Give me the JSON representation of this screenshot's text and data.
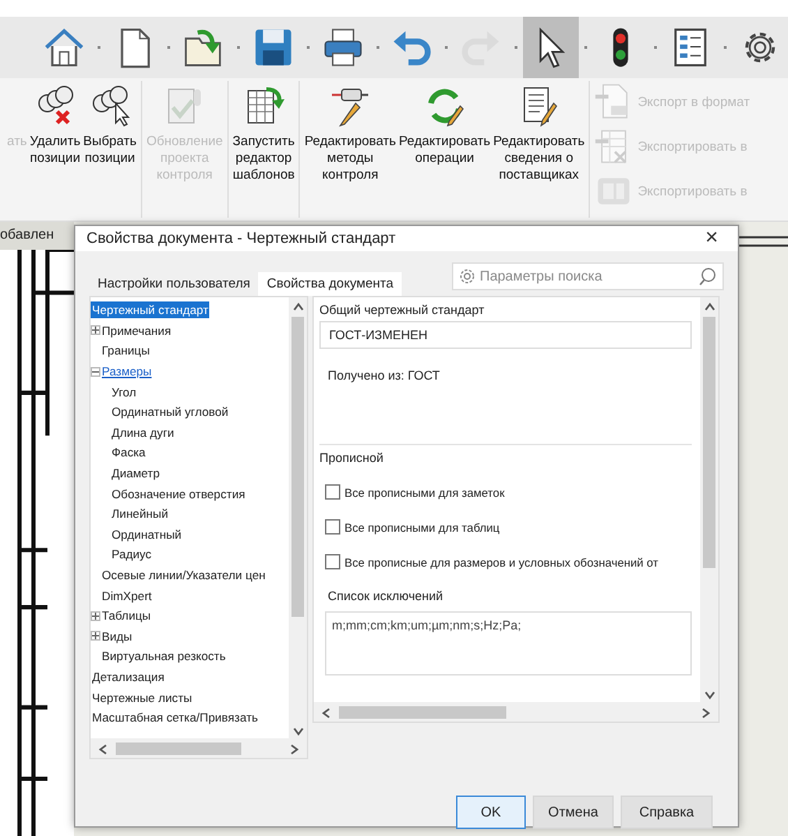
{
  "quick_toolbar": [
    {
      "kind": "home",
      "selected": false,
      "disabled": false
    },
    {
      "kind": "new",
      "selected": false,
      "disabled": false
    },
    {
      "kind": "open",
      "selected": false,
      "disabled": false
    },
    {
      "kind": "save",
      "selected": false,
      "disabled": false
    },
    {
      "kind": "print",
      "selected": false,
      "disabled": false
    },
    {
      "kind": "undo",
      "selected": false,
      "disabled": false
    },
    {
      "kind": "redo",
      "selected": false,
      "disabled": true
    },
    {
      "kind": "pointer",
      "selected": true,
      "disabled": false
    },
    {
      "kind": "traffic",
      "selected": false,
      "disabled": false
    },
    {
      "kind": "list",
      "selected": false,
      "disabled": false
    },
    {
      "kind": "gear",
      "selected": false,
      "disabled": false
    }
  ],
  "ribbon": {
    "buttons": [
      {
        "kind": "text",
        "lines": [
          "ать"
        ],
        "disabled": true
      },
      {
        "kind": "delete",
        "lines": [
          "Удалить",
          "позиции"
        ],
        "disabled": false
      },
      {
        "kind": "pick",
        "lines": [
          "Выбрать",
          "позиции"
        ],
        "disabled": false
      },
      {
        "kind": "update",
        "lines": [
          "Обновление",
          "проекта",
          "контроля"
        ],
        "disabled": true
      },
      {
        "kind": "template",
        "lines": [
          "Запустить",
          "редактор",
          "шаблонов"
        ],
        "disabled": false
      },
      {
        "kind": "gauge",
        "lines": [
          "Редактировать",
          "методы",
          "контроля"
        ],
        "disabled": false
      },
      {
        "kind": "cycle",
        "lines": [
          "Редактировать",
          "операции"
        ],
        "disabled": false
      },
      {
        "kind": "doc",
        "lines": [
          "Редактировать",
          "сведения о",
          "поставщиках"
        ],
        "disabled": false
      }
    ],
    "exports": [
      {
        "kind": "pdf",
        "label": "Экспорт в формат",
        "disabled": true
      },
      {
        "kind": "excel",
        "label": "Экспортировать в",
        "disabled": true
      },
      {
        "kind": "sw",
        "label": "Экспортировать в",
        "disabled": true
      }
    ]
  },
  "workspace": {
    "tab_label": "обавлен"
  },
  "dialog": {
    "title": "Свойства документа - Чертежный стандарт",
    "close": "×",
    "tabs": [
      {
        "label": "Настройки пользователя",
        "selected": false
      },
      {
        "label": "Свойства документа",
        "selected": true
      }
    ],
    "search": {
      "placeholder": "Параметры поиска"
    },
    "tree": [
      {
        "label": "Чертежный стандарт",
        "selected": true,
        "hovered": false,
        "children": [
          {
            "label": "Примечания",
            "selected": false,
            "hovered": false,
            "expanded": false
          },
          {
            "label": "Границы",
            "selected": false,
            "hovered": false
          },
          {
            "label": "Размеры",
            "selected": false,
            "hovered": true,
            "expanded": true,
            "children": [
              {
                "label": "Угол",
                "selected": false,
                "hovered": false
              },
              {
                "label": "Ординатный угловой",
                "selected": false,
                "hovered": false
              },
              {
                "label": "Длина дуги",
                "selected": false,
                "hovered": false
              },
              {
                "label": "Фаска",
                "selected": false,
                "hovered": false
              },
              {
                "label": "Диаметр",
                "selected": false,
                "hovered": false
              },
              {
                "label": "Обозначение отверстия",
                "selected": false,
                "hovered": false
              },
              {
                "label": "Линейный",
                "selected": false,
                "hovered": false
              },
              {
                "label": "Ординатный",
                "selected": false,
                "hovered": false
              },
              {
                "label": "Радиус",
                "selected": false,
                "hovered": false
              }
            ]
          },
          {
            "label": "Осевые линии/Указатели цен",
            "selected": false,
            "hovered": false
          },
          {
            "label": "DimXpert",
            "selected": false,
            "hovered": false
          },
          {
            "label": "Таблицы",
            "selected": false,
            "hovered": false,
            "expanded": false
          },
          {
            "label": "Виды",
            "selected": false,
            "hovered": false,
            "expanded": false
          },
          {
            "label": "Виртуальная резкость",
            "selected": false,
            "hovered": false
          }
        ]
      },
      {
        "label": "Детализация",
        "selected": false,
        "hovered": false
      },
      {
        "label": "Чертежные листы",
        "selected": false,
        "hovered": false
      },
      {
        "label": "Масштабная сетка/Привязать",
        "selected": false,
        "hovered": false
      }
    ],
    "standard": {
      "heading": "Общий чертежный стандарт",
      "value": "ГОСТ-ИЗМЕНЕН",
      "source": "Получено из: ГОСТ"
    },
    "caps": {
      "heading": "Прописной",
      "checkboxes": [
        {
          "label": "Все прописными для заметок",
          "checked": false
        },
        {
          "label": "Все прописными для таблиц",
          "checked": false
        },
        {
          "label": "Все прописные для размеров и условных обозначений от",
          "checked": false
        }
      ],
      "exceptions_label": "Список исключений",
      "exceptions_value": "m;mm;cm;km;um;µm;nm;s;Hz;Pa;"
    },
    "buttons": [
      {
        "label": "OK",
        "selected": true
      },
      {
        "label": "Отмена",
        "selected": false
      },
      {
        "label": "Справка",
        "selected": false
      }
    ]
  }
}
